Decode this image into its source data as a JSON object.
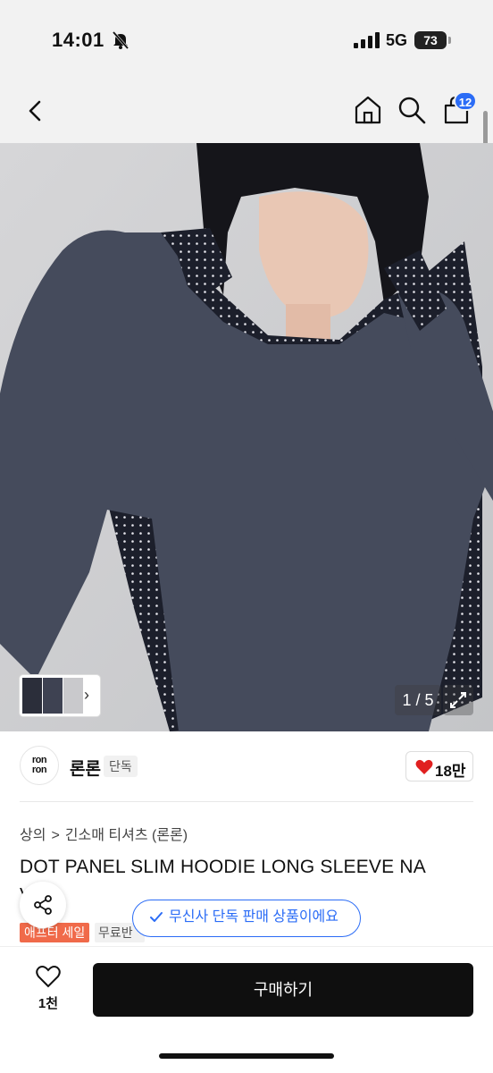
{
  "status_bar": {
    "time": "14:01",
    "network": "5G",
    "battery": "73"
  },
  "nav": {
    "cart_count": "12"
  },
  "gallery": {
    "counter": "1 / 5"
  },
  "brand": {
    "logo_text_line1": "ron",
    "logo_text_line2": "ron",
    "name": "론론",
    "tag": "단독",
    "like_count": "18만"
  },
  "breadcrumb": {
    "level1": "상의",
    "separator": ">",
    "level2": "긴소매 티셔츠 (론론)"
  },
  "product": {
    "title": "DOT PANEL SLIM HOODIE LONG SLEEVE NA",
    "title_overflow": "V"
  },
  "toast": {
    "text": "무신사 단독 판매 상품이에요"
  },
  "tags": {
    "sale": "애프터 세일",
    "free": "무료반품"
  },
  "bottom_bar": {
    "wish_count": "1천",
    "buy_label": "구매하기"
  },
  "colors": {
    "accent_blue": "#2b6cf6",
    "sale_orange": "#f06a4a",
    "heart_red": "#e02020",
    "buy_black": "#0f0f0f"
  }
}
